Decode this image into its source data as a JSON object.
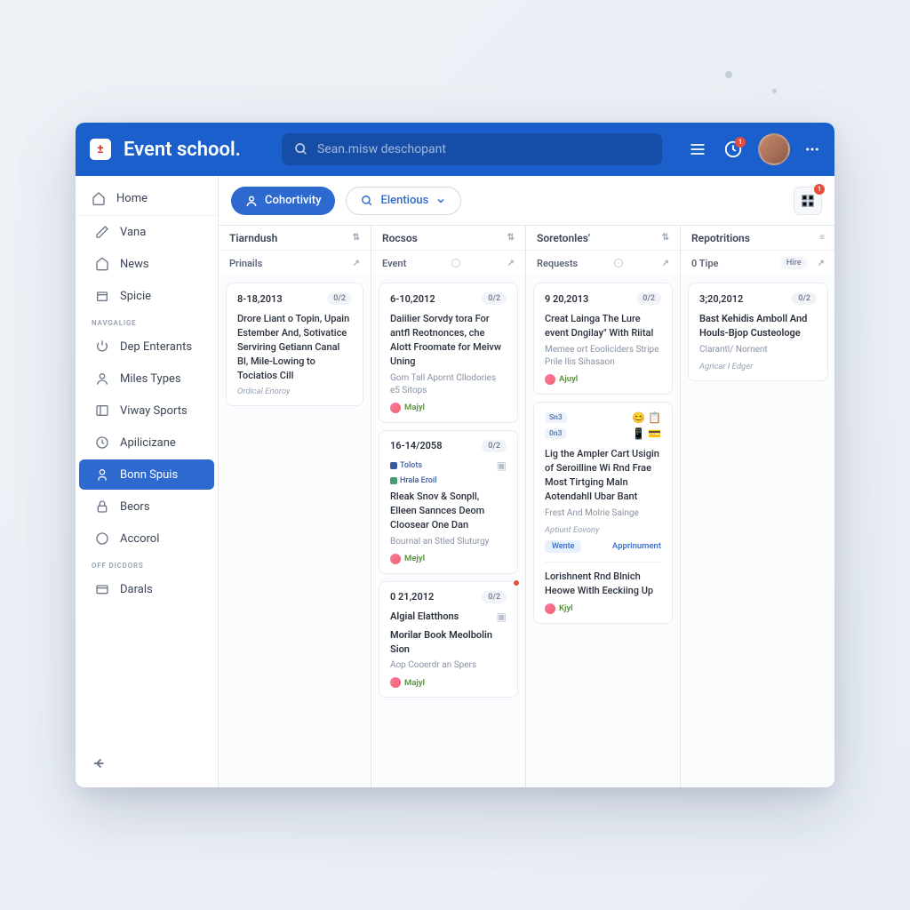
{
  "app": {
    "title": "Event school.",
    "logo_glyph": "±"
  },
  "search": {
    "placeholder": "Sean.misw deschopant"
  },
  "header": {
    "notif_count": "1"
  },
  "sidebar": {
    "home": "Home",
    "top": [
      {
        "label": "Vana"
      },
      {
        "label": "News"
      },
      {
        "label": "Spicie"
      }
    ],
    "section1": "NAVGALIGE",
    "mid": [
      {
        "label": "Dep Enterants"
      },
      {
        "label": "Miles Types"
      },
      {
        "label": "Viway Sports"
      },
      {
        "label": "Apilicizane"
      },
      {
        "label": "Bonn Spuis"
      },
      {
        "label": "Beors"
      },
      {
        "label": "Accorol"
      }
    ],
    "section2": "OFF DICDORS",
    "bot": [
      {
        "label": "Darals"
      }
    ]
  },
  "toolbar": {
    "primary": "Cohortivity",
    "outline": "Elentious",
    "grid_badge": "1"
  },
  "columns": [
    {
      "head": "Tiarndush",
      "sub": "Prinails",
      "cards": [
        {
          "date": "8-18,2013",
          "badge": "0/2",
          "title": "Drore Liant o Topin, Upain Estember And, Sotivatice Serviring Getiann Canal Bl, Mile-Lowing to Tociatios Cill",
          "meta": "Ordical Enoroy"
        }
      ]
    },
    {
      "head": "Rocsоs",
      "sub": "Event",
      "cards": [
        {
          "date": "6-10,2012",
          "badge": "0/2",
          "title": "Daiilier Sorvdy tora For antfl Reotnonces, che Alott Froomate for Meivw Uning",
          "sub": "Gom Tall Apornt Cllodories e5 Sitops",
          "foot": "Majyl"
        },
        {
          "date": "16-14/2058",
          "badge": "0/2",
          "tags": [
            {
              "t": "Tolots"
            },
            {
              "t": "Hrala Eroil"
            }
          ],
          "title": "Rleak Snov & Sonpll, Elleen Sannces Deom Cloosear One Dan",
          "sub": "Bournal an Stled Sluturgy",
          "foot": "Mejyl"
        },
        {
          "date": "0 21,2012",
          "badge": "0/2",
          "heading": "Algial Elatthons",
          "title": "Morilar Book Meolbolin Sion",
          "sub": "Aop Cooerdr an Spers",
          "foot": "Majyl",
          "hasRedDot": true
        }
      ]
    },
    {
      "head": "Soretonles'",
      "sub": "Requests",
      "cards": [
        {
          "date": "9 20,2013",
          "badge": "0/2",
          "title": "Creat Lainga The Lure event Dngilay\" With Riital",
          "sub": "Memee ort Eooliciders Stripe Prile Ilis Sihasaon",
          "foot": "Ajuyl"
        },
        {
          "emoji_top": true,
          "title": "Lig the Ampler Cart Usigin of Seroilline Wi Rnd Frae Most Tirtging Maln Aotendahll Ubar Bant",
          "sub": "Frest And Molrie Sainge",
          "meta": "Aptiunt Eovony",
          "link_l": "Wente",
          "link_r": "Apprinument",
          "extra_title": "Lorishnent Rnd Blnich Heowe Witlh Eeckiing Up",
          "extra_foot": "Kjyl"
        }
      ]
    },
    {
      "head": "Repotritions",
      "sub": "0 Tipe",
      "sub_badge": "Hire",
      "cards": [
        {
          "date": "3;20,2012",
          "badge": "0/2",
          "title": "Bast Kehidis Amboll And Houls-Bjop Custeologe",
          "sub": "Clarantl/ Nornent",
          "meta": "Agricar I Edger"
        }
      ]
    }
  ]
}
